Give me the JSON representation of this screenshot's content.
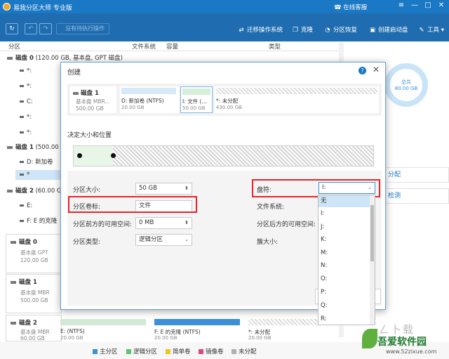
{
  "app": {
    "title": "易我分区大师 专业版",
    "online_service": "在线客服",
    "window_buttons": [
      "≡",
      "—",
      "□",
      "✕"
    ]
  },
  "toolbar": {
    "refresh_icon": "↻",
    "undo_icon": "↶",
    "redo_icon": "↷",
    "pending": "没有待执行操作",
    "items": [
      {
        "icon": "migrate-icon",
        "label": "迁移操作系统"
      },
      {
        "icon": "clone-icon",
        "label": "克隆"
      },
      {
        "icon": "recovery-icon",
        "label": "分区恢复"
      },
      {
        "icon": "bootdisk-icon",
        "label": "创建启动盘"
      },
      {
        "icon": "tools-icon",
        "label": "工具"
      }
    ]
  },
  "columns": {
    "partition": "分区",
    "filesystem": "文件系统",
    "capacity": "容量",
    "type": "类型"
  },
  "tree": [
    {
      "kind": "disk",
      "label": "磁盘 0",
      "detail": " (120.00 GB, 基本盘, GPT 磁盘)"
    },
    {
      "kind": "part",
      "label": "*:"
    },
    {
      "kind": "part",
      "label": "*:"
    },
    {
      "kind": "part",
      "label": "C:"
    },
    {
      "kind": "part",
      "label": "*:"
    },
    {
      "kind": "part",
      "label": "*:"
    },
    {
      "kind": "disk",
      "label": "磁盘 1",
      "detail": " (500.00"
    },
    {
      "kind": "part",
      "label": "D: 新加卷"
    },
    {
      "kind": "part",
      "label": "*"
    },
    {
      "kind": "disk",
      "label": "磁盘 2",
      "detail": " (60.00 G"
    },
    {
      "kind": "part",
      "label": "E:"
    },
    {
      "kind": "part",
      "label": "F: E 的克隆"
    }
  ],
  "cards": [
    {
      "title": "磁盘 0",
      "type": "基本盘 GPT",
      "size": "120.00 GB"
    },
    {
      "title": "磁盘 1",
      "type": "基本盘 MBR",
      "size": "500.00 GB"
    },
    {
      "title": "磁盘 2",
      "type": "基本盘 MBR",
      "size": "60.00 GB"
    }
  ],
  "bottom_strip": [
    {
      "name": "E: (NTFS)",
      "size": "20.00 GB"
    },
    {
      "name": "F: E 的克隆 (NTFS)",
      "size": "20.00 GB"
    },
    {
      "name": "*: 未分配",
      "size": "20.00 GB"
    }
  ],
  "right_panel": {
    "donut_label": "总共",
    "donut_value": "80.00 GB",
    "btn1": "分配",
    "btn2": "检测"
  },
  "legend": [
    {
      "label": "主分区",
      "color": "#3a8fd6"
    },
    {
      "label": "逻辑分区",
      "color": "#5cc46c"
    },
    {
      "label": "简单卷",
      "color": "#f0c419"
    },
    {
      "label": "镜像卷",
      "color": "#e0457b"
    },
    {
      "label": "未分配",
      "color": "#b0b0b0"
    }
  ],
  "dialog": {
    "title": "创建",
    "help": "?",
    "close": "✕",
    "disk": {
      "title": "磁盘 1",
      "type": "基本盘 MBR...",
      "size": "500.00 GB"
    },
    "segments": [
      {
        "name": "D: 新加卷 (NTFS)",
        "size": "20.00 GB"
      },
      {
        "name": "I: 文件 (...",
        "size": "50.00 GB"
      },
      {
        "name": "*: 未分配",
        "size": "430.00 GB"
      }
    ],
    "section_label": "决定大小和位置",
    "form": {
      "size_label": "分区大小:",
      "size_value": "50 GB",
      "volume_label": "分区卷标:",
      "volume_value": "文件",
      "before_label": "分区前方的可用空间:",
      "before_value": "0 MB",
      "ptype_label": "分区类型:",
      "ptype_value": "逻辑分区",
      "letter_label": "盘符:",
      "letter_value": "I:",
      "fs_label": "文件系统:",
      "after_label": "分区后方的可用空间:",
      "cluster_label": "簇大小:"
    },
    "dropdown_options": [
      "无",
      "I:",
      "J:",
      "K:",
      "M:",
      "N:",
      "O:",
      "P:",
      "Q:",
      "R:"
    ]
  },
  "watermark": {
    "line": "ㄥ卜载",
    "name": "吾爱软件园",
    "url": "www.52zixue.com"
  }
}
